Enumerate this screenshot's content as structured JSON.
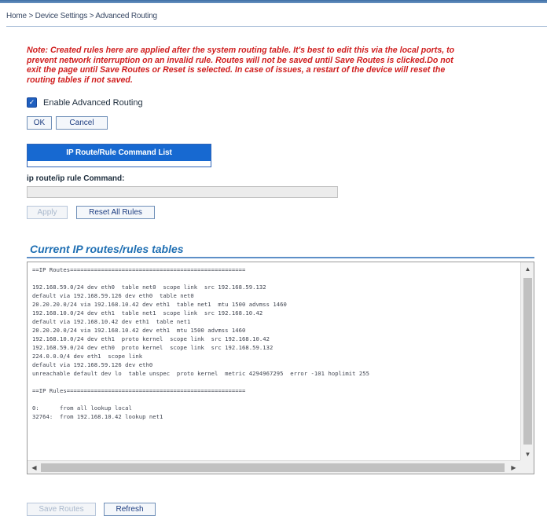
{
  "breadcrumb": "Home > Device Settings > Advanced Routing",
  "note_lines": [
    "Note: Created rules here are applied after the system routing table. It's best to edit this via the local ports, to",
    "prevent network interruption on an invalid rule. Routes will not be saved until Save Routes is clicked.Do not",
    "exit the page until Save Routes or Reset is selected. In case of issues, a restart of the device will reset the",
    "routing tables if not saved."
  ],
  "enable_label": "Enable Advanced Routing",
  "enable_checked": true,
  "ok_label": "OK",
  "cancel_label": "Cancel",
  "tab_label": "IP Route/Rule Command List",
  "command_label": "ip route/ip rule Command:",
  "command_value": "",
  "apply_label": "Apply",
  "reset_label": "Reset All Rules",
  "section_title": "Current IP routes/rules tables",
  "console_lines": [
    "==IP Routes===================================================",
    "",
    "192.168.59.0/24 dev eth0  table net0  scope link  src 192.168.59.132",
    "default via 192.168.59.126 dev eth0  table net0",
    "20.20.20.0/24 via 192.168.10.42 dev eth1  table net1  mtu 1500 advmss 1460",
    "192.168.10.0/24 dev eth1  table net1  scope link  src 192.168.10.42",
    "default via 192.168.10.42 dev eth1  table net1",
    "20.20.20.0/24 via 192.168.10.42 dev eth1  mtu 1500 advmss 1460",
    "192.168.10.0/24 dev eth1  proto kernel  scope link  src 192.168.10.42",
    "192.168.59.0/24 dev eth0  proto kernel  scope link  src 192.168.59.132",
    "224.0.0.0/4 dev eth1  scope link",
    "default via 192.168.59.126 dev eth0",
    "unreachable default dev lo  table unspec  proto kernel  metric 4294967295  error -101 hoplimit 255",
    "",
    "==IP Rules====================================================",
    "",
    "0:      from all lookup local",
    "32764:  from 192.168.10.42 lookup net1"
  ],
  "save_label": "Save Routes",
  "refresh_label": "Refresh"
}
